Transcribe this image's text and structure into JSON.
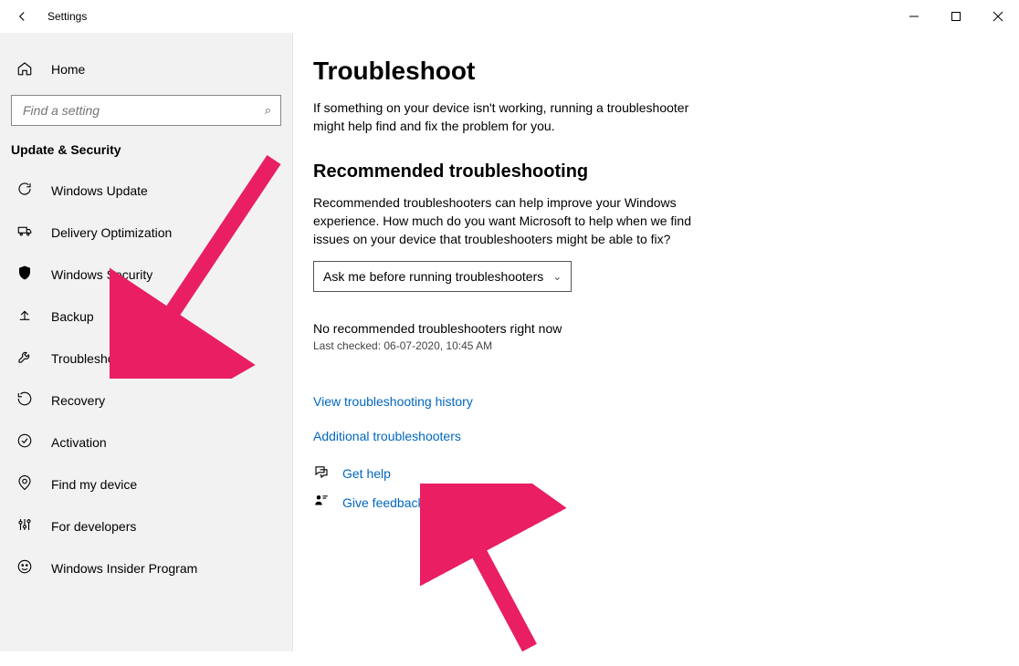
{
  "window": {
    "title": "Settings"
  },
  "sidebar": {
    "home": "Home",
    "search_placeholder": "Find a setting",
    "section": "Update & Security",
    "items": [
      {
        "label": "Windows Update"
      },
      {
        "label": "Delivery Optimization"
      },
      {
        "label": "Windows Security"
      },
      {
        "label": "Backup"
      },
      {
        "label": "Troubleshoot"
      },
      {
        "label": "Recovery"
      },
      {
        "label": "Activation"
      },
      {
        "label": "Find my device"
      },
      {
        "label": "For developers"
      },
      {
        "label": "Windows Insider Program"
      }
    ]
  },
  "main": {
    "title": "Troubleshoot",
    "intro": "If something on your device isn't working, running a troubleshooter might help find and fix the problem for you.",
    "rec_heading": "Recommended troubleshooting",
    "rec_desc": "Recommended troubleshooters can help improve your Windows experience. How much do you want Microsoft to help when we find issues on your device that troubleshooters might be able to fix?",
    "dropdown_value": "Ask me before running troubleshooters",
    "no_rec": "No recommended troubleshooters right now",
    "last_checked": "Last checked: 06-07-2020, 10:45 AM",
    "history_link": "View troubleshooting history",
    "additional_link": "Additional troubleshooters",
    "get_help": "Get help",
    "give_feedback": "Give feedback"
  }
}
